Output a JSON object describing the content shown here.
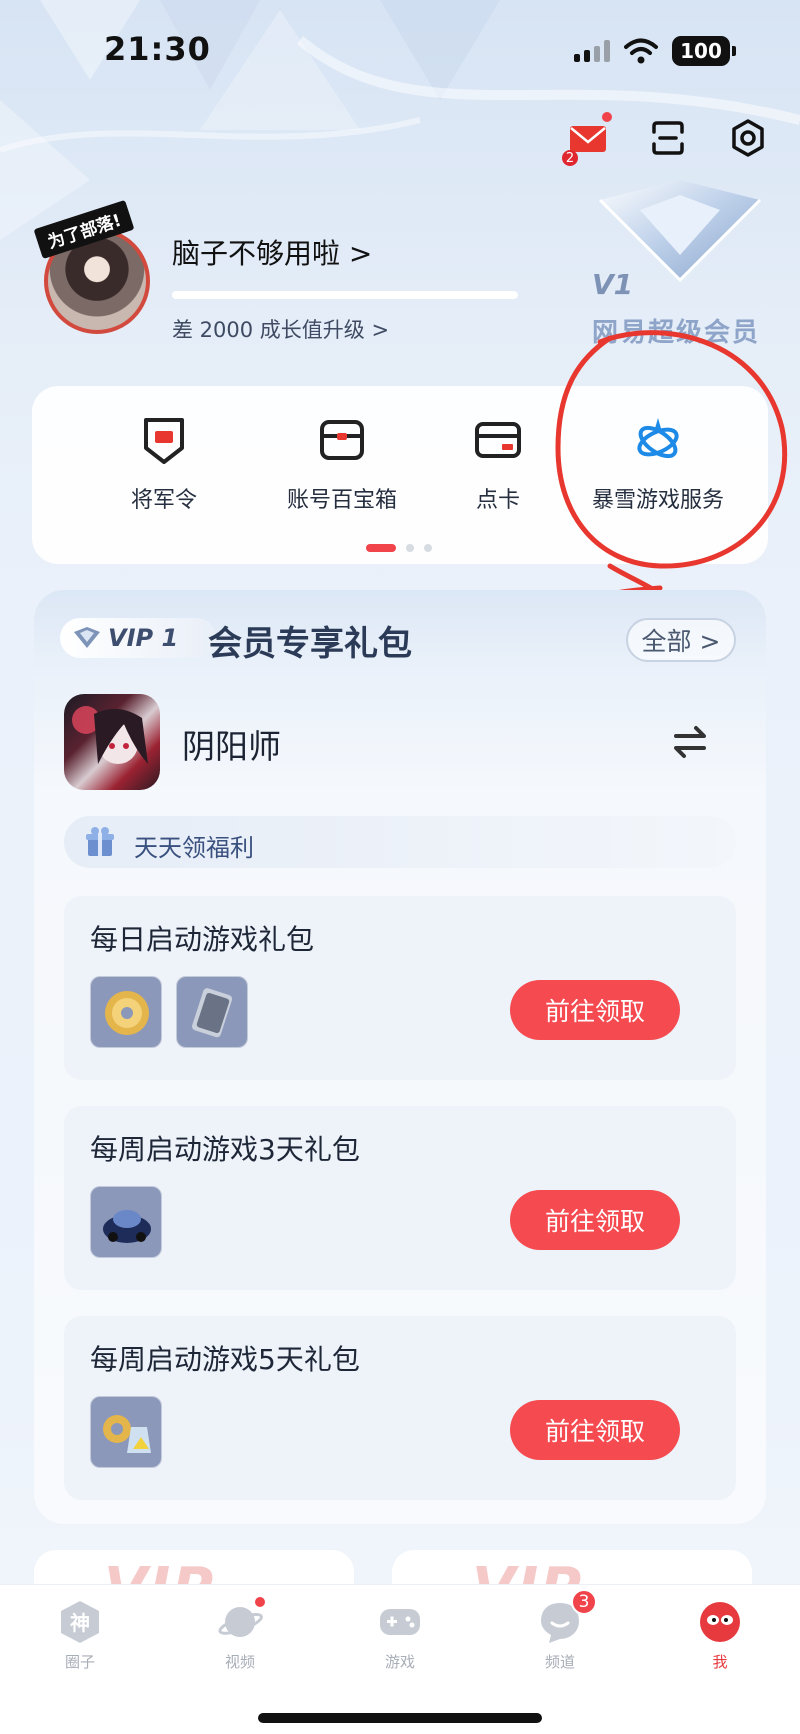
{
  "status_bar": {
    "time": "21:30",
    "battery": "100"
  },
  "header": {
    "mail_badge_count": "2"
  },
  "profile": {
    "avatar_tag": "为了部落!",
    "username": "脑子不够用啦 >",
    "upgrade_text": "差 2000 成长值升级 >",
    "progress_fraction": 0.0
  },
  "vip_badge": {
    "level": "V1",
    "title": "网易超级会员"
  },
  "services": {
    "items": [
      {
        "label": "将军令",
        "icon": "general-order-icon"
      },
      {
        "label": "账号百宝箱",
        "icon": "account-treasure-box-icon"
      },
      {
        "label": "点卡",
        "icon": "point-card-icon"
      },
      {
        "label": "暴雪游戏服务",
        "icon": "blizzard-icon"
      }
    ],
    "page_count": 3,
    "active_page": 1
  },
  "gift_panel": {
    "vip_tag": "VIP 1",
    "title": "会员专享礼包",
    "all_label": "全部 >",
    "game_name": "阴阳师",
    "daily_label": "天天领福利",
    "items": [
      {
        "title": "每日启动游戏礼包",
        "button": "前往领取",
        "thumbs": [
          "coin-reward",
          "ticket-reward"
        ]
      },
      {
        "title": "每周启动游戏3天礼包",
        "button": "前往领取",
        "thumbs": [
          "car-reward"
        ]
      },
      {
        "title": "每周启动游戏5天礼包",
        "button": "前往领取",
        "thumbs": [
          "coin-bag-reward"
        ]
      }
    ]
  },
  "tabbar": {
    "tabs": [
      {
        "label": "圈子",
        "icon": "shen-icon"
      },
      {
        "label": "视频",
        "icon": "planet-icon"
      },
      {
        "label": "游戏",
        "icon": "gamepad-icon"
      },
      {
        "label": "频道",
        "icon": "channel-icon",
        "badge": "3"
      },
      {
        "label": "我",
        "icon": "me-icon"
      }
    ]
  },
  "colors": {
    "accent": "#f44a50",
    "annotation": "#e8372f",
    "text_primary": "#1c2433"
  }
}
